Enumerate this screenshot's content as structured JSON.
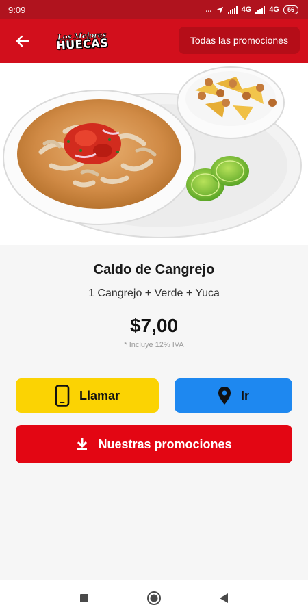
{
  "status_bar": {
    "time": "9:09",
    "indicators": "...",
    "network1": "4G",
    "network2": "4G",
    "battery": "56"
  },
  "app_bar": {
    "logo_line1": "Los Mejores",
    "logo_line2": "HUECAS",
    "promos_button": "Todas las promociones"
  },
  "product": {
    "name": "Caldo de Cangrejo",
    "description": "1 Cangrejo + Verde + Yuca",
    "price": "$7,00",
    "tax_note": "* Incluye 12% IVA"
  },
  "actions": {
    "call_label": "Llamar",
    "go_label": "Ir",
    "promos_label": "Nuestras promociones"
  },
  "colors": {
    "status_bar": "#b0131e",
    "app_bar": "#d20f1c",
    "call_button": "#fbd303",
    "go_button": "#1e88f0",
    "promos_button": "#e30613"
  },
  "icons": {
    "back": "arrow-left-icon",
    "call": "phone-icon",
    "go": "location-pin-icon",
    "promos": "download-icon",
    "nav_recent": "square-icon",
    "nav_home": "circle-icon",
    "nav_back": "triangle-icon"
  }
}
